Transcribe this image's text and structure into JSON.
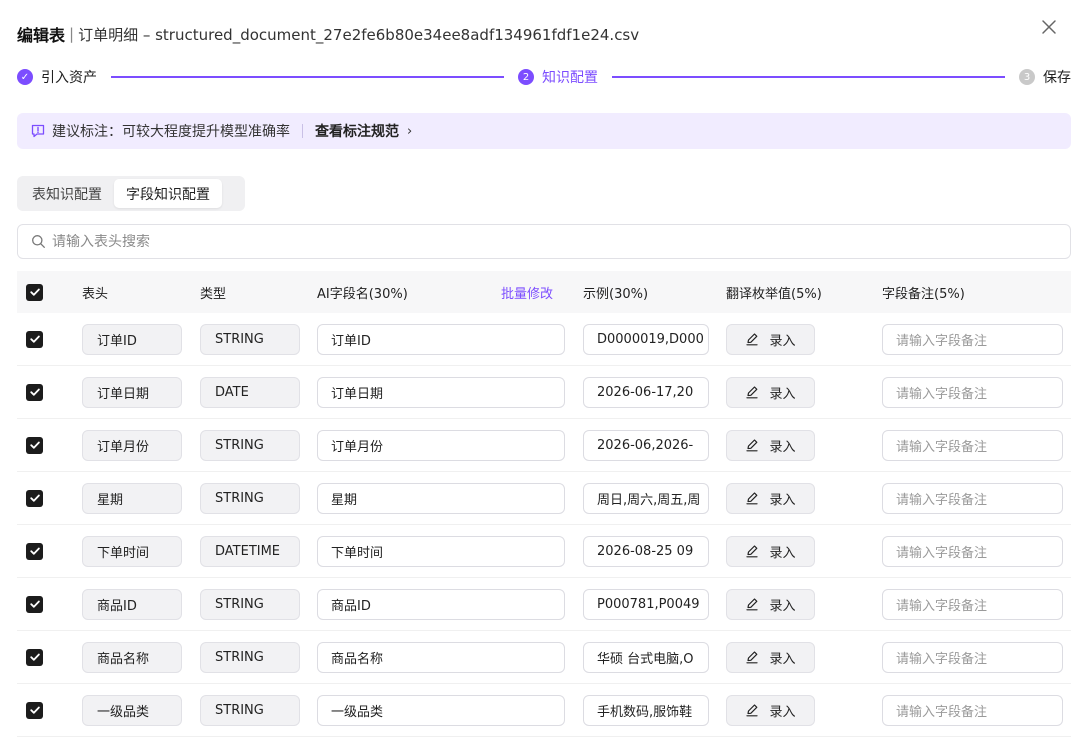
{
  "header": {
    "title": "编辑表",
    "separator": "|",
    "subtitle": "订单明细 – structured_document_27e2fe6b80e34ee8adf134961fdf1e24.csv"
  },
  "steps": [
    {
      "label": "引入资产",
      "number": "✓",
      "status": "done"
    },
    {
      "label": "知识配置",
      "number": "2",
      "status": "active"
    },
    {
      "label": "保存",
      "number": "3",
      "status": "pending"
    }
  ],
  "notice": {
    "text": "建议标注：可较大程度提升模型准确率",
    "link": "查看标注规范",
    "chevron": "›"
  },
  "tabs": [
    {
      "label": "表知识配置",
      "active": false
    },
    {
      "label": "字段知识配置",
      "active": true
    }
  ],
  "search": {
    "placeholder": "请输入表头搜索",
    "value": ""
  },
  "table": {
    "columns": {
      "header": "表头",
      "type": "类型",
      "ai_name": "AI字段名(30%)",
      "batch_edit": "批量修改",
      "example": "示例(30%)",
      "translate": "翻译枚举值(5%)",
      "note": "字段备注(5%)"
    },
    "entry_label": "录入",
    "note_placeholder": "请输入字段备注",
    "rows": [
      {
        "header": "订单ID",
        "type": "STRING",
        "ai_name": "订单ID",
        "example": "D0000019,D000",
        "checked": true
      },
      {
        "header": "订单日期",
        "type": "DATE",
        "ai_name": "订单日期",
        "example": "2026-06-17,20",
        "checked": true
      },
      {
        "header": "订单月份",
        "type": "STRING",
        "ai_name": "订单月份",
        "example": "2026-06,2026-",
        "checked": true
      },
      {
        "header": "星期",
        "type": "STRING",
        "ai_name": "星期",
        "example": "周日,周六,周五,周",
        "checked": true
      },
      {
        "header": "下单时间",
        "type": "DATETIME",
        "ai_name": "下单时间",
        "example": "2026-08-25 09",
        "checked": true
      },
      {
        "header": "商品ID",
        "type": "STRING",
        "ai_name": "商品ID",
        "example": "P000781,P0049",
        "checked": true
      },
      {
        "header": "商品名称",
        "type": "STRING",
        "ai_name": "商品名称",
        "example": "华硕 台式电脑,O",
        "checked": true
      },
      {
        "header": "一级品类",
        "type": "STRING",
        "ai_name": "一级品类",
        "example": "手机数码,服饰鞋",
        "checked": true
      }
    ]
  },
  "colors": {
    "accent": "#7c4dff",
    "notice_bg": "#f1ecff"
  }
}
